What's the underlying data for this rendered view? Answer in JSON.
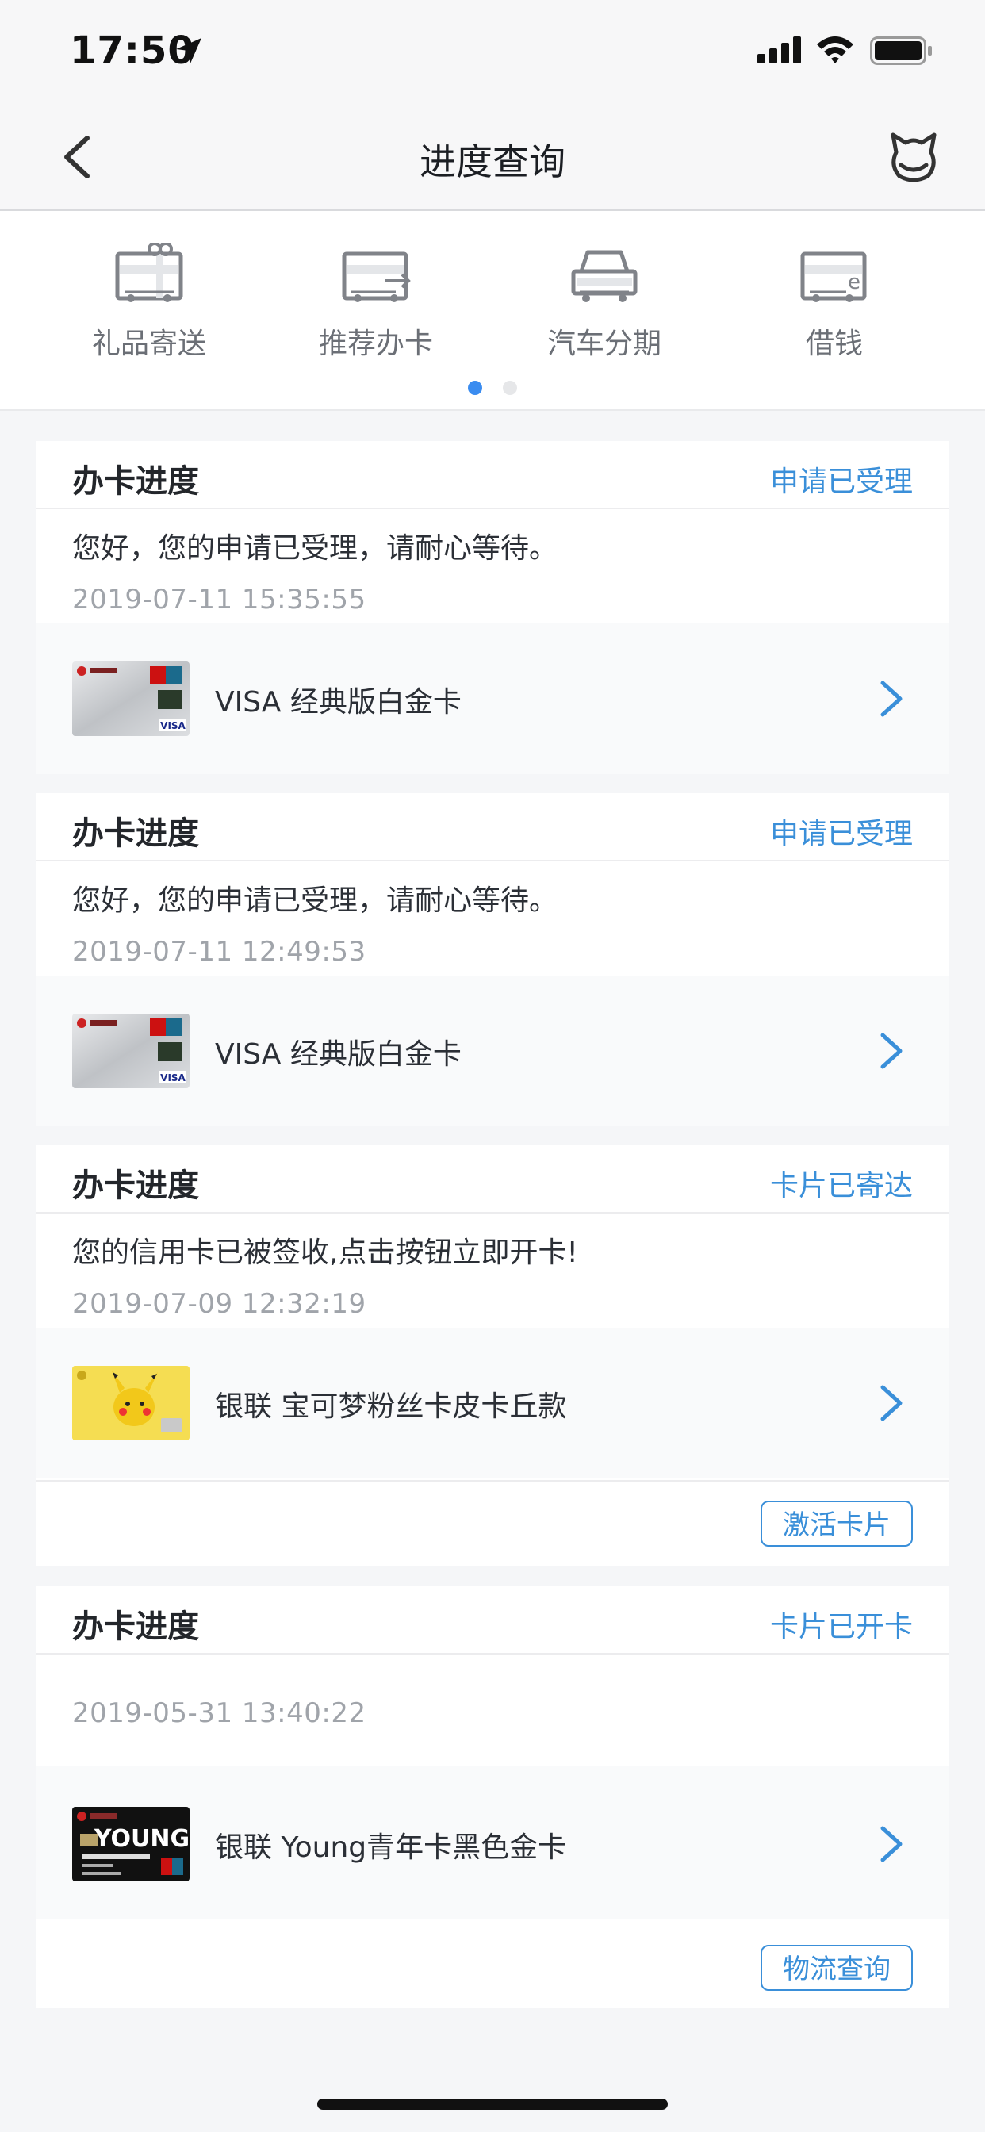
{
  "status_bar": {
    "time": "17:50"
  },
  "nav": {
    "title": "进度查询"
  },
  "quick_menu": {
    "items": [
      {
        "label": "礼品寄送",
        "icon": "gift-icon"
      },
      {
        "label": "推荐办卡",
        "icon": "recommend-card-icon"
      },
      {
        "label": "汽车分期",
        "icon": "car-icon"
      },
      {
        "label": "借钱",
        "icon": "loan-icon"
      }
    ],
    "page_count": 2,
    "active_page": 1
  },
  "cards": [
    {
      "title": "办卡进度",
      "status": "申请已受理",
      "message": "您好，您的申请已受理，请耐心等待。",
      "time": "2019-07-11 15:35:55",
      "product": "VISA 经典版白金卡"
    },
    {
      "title": "办卡进度",
      "status": "申请已受理",
      "message": "您好，您的申请已受理，请耐心等待。",
      "time": "2019-07-11 12:49:53",
      "product": "VISA 经典版白金卡"
    },
    {
      "title": "办卡进度",
      "status": "卡片已寄达",
      "message": "您的信用卡已被签收,点击按钮立即开卡!",
      "time": "2019-07-09 12:32:19",
      "product": "银联 宝可梦粉丝卡皮卡丘款",
      "action": "激活卡片"
    },
    {
      "title": "办卡进度",
      "status": "卡片已开卡",
      "message": "",
      "time": "2019-05-31 13:40:22",
      "product": "银联 Young青年卡黑色金卡",
      "action": "物流查询",
      "card_text": "YOUNG"
    }
  ],
  "colors": {
    "accent": "#3a8fd9",
    "active_dot": "#3a8cf0"
  }
}
